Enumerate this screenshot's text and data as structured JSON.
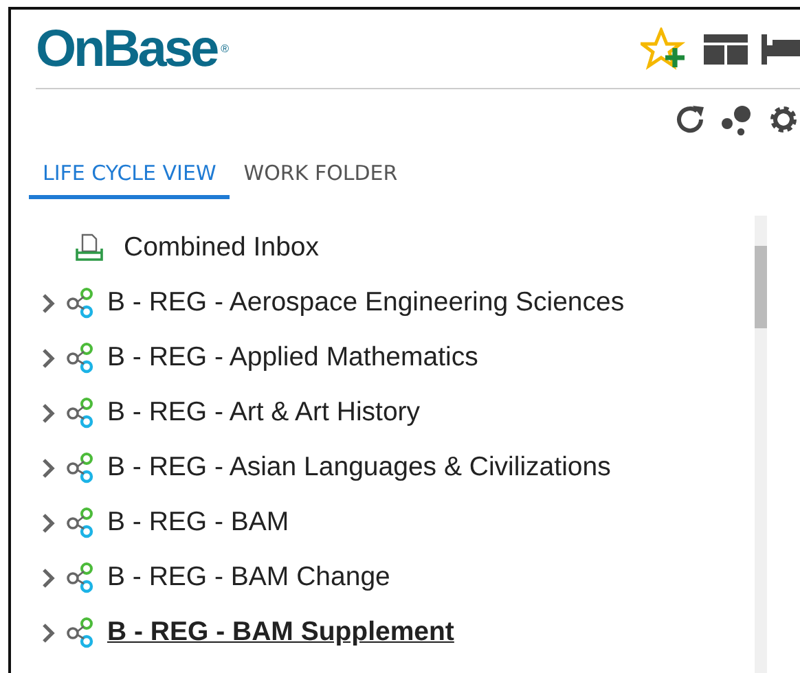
{
  "header": {
    "logo": "OnBase",
    "logo_mark": "®"
  },
  "tabs": [
    {
      "label": "LIFE CYCLE VIEW",
      "selected": true
    },
    {
      "label": "WORK FOLDER",
      "selected": false
    }
  ],
  "tree": [
    {
      "kind": "inbox",
      "label": "Combined Inbox",
      "selected": false
    },
    {
      "kind": "lifecycle",
      "label": "B - REG - Aerospace Engineering Sciences",
      "expanded": false,
      "selected": false
    },
    {
      "kind": "lifecycle",
      "label": "B - REG - Applied Mathematics",
      "expanded": false,
      "selected": false
    },
    {
      "kind": "lifecycle",
      "label": "B - REG - Art & Art History",
      "expanded": false,
      "selected": false
    },
    {
      "kind": "lifecycle",
      "label": "B - REG - Asian Languages & Civilizations",
      "expanded": false,
      "selected": false
    },
    {
      "kind": "lifecycle",
      "label": "B - REG - BAM",
      "expanded": false,
      "selected": false
    },
    {
      "kind": "lifecycle",
      "label": "B - REG - BAM Change",
      "expanded": false,
      "selected": false
    },
    {
      "kind": "lifecycle",
      "label": "B - REG - BAM Supplement",
      "expanded": false,
      "selected": true
    }
  ]
}
